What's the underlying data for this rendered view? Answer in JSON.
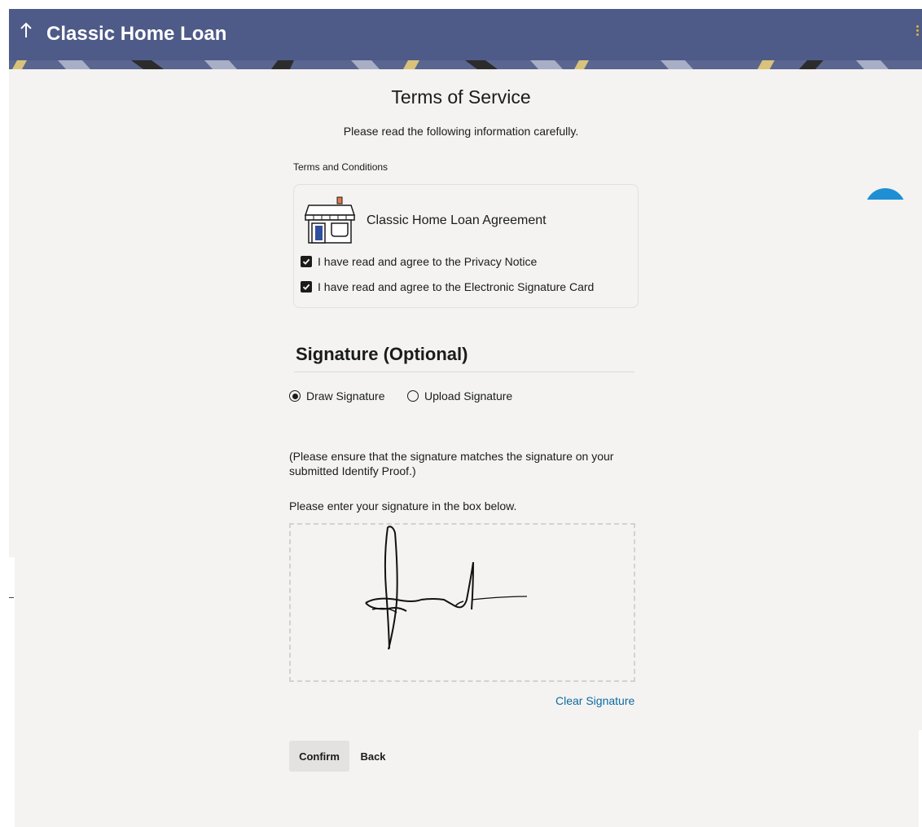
{
  "header": {
    "title": "Classic Home Loan",
    "back_icon": "arrow-up-icon",
    "menu_icon": "kebab-menu-icon"
  },
  "page": {
    "heading": "Terms of Service",
    "subheading": "Please read the following information carefully."
  },
  "terms": {
    "section_label": "Terms and Conditions",
    "agreement_title": "Classic Home Loan Agreement",
    "agreement_icon": "store-icon",
    "checkboxes": [
      {
        "label": "I have read and agree to the Privacy Notice",
        "checked": true
      },
      {
        "label": "I have read and agree to the Electronic Signature Card",
        "checked": true
      }
    ]
  },
  "signature": {
    "title": "Signature (Optional)",
    "options": [
      {
        "label": "Draw Signature",
        "selected": true
      },
      {
        "label": "Upload Signature",
        "selected": false
      }
    ],
    "note": "(Please ensure that the signature matches the signature on your submitted Identify Proof.)",
    "instruction": "Please enter your signature in the box below.",
    "clear_label": "Clear Signature"
  },
  "actions": {
    "confirm_label": "Confirm",
    "back_label": "Back"
  },
  "colors": {
    "header_bg": "#4e5a87",
    "page_bg": "#f4f3f2",
    "link": "#0e6aa1",
    "float_button": "#1f8fd3"
  }
}
